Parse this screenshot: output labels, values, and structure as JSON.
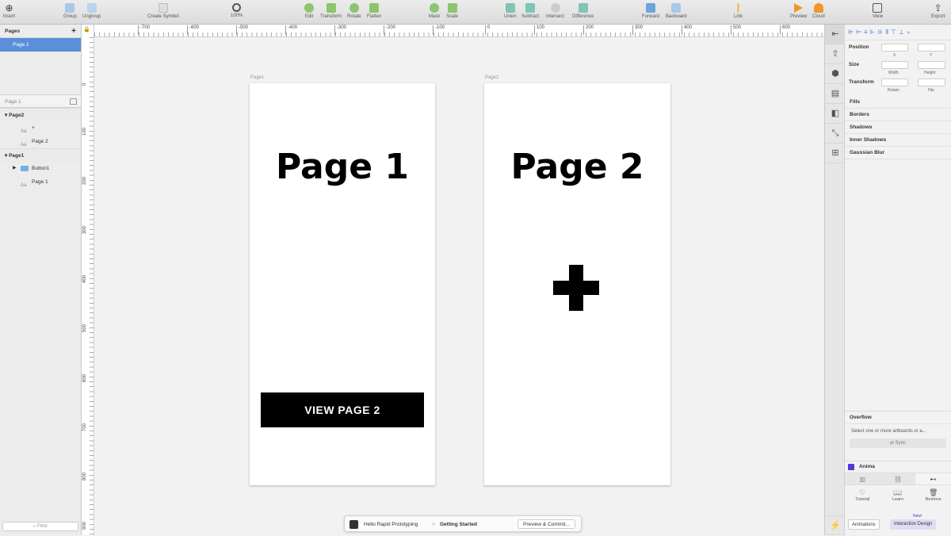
{
  "toolbar": {
    "insert": "Insert",
    "group": "Group",
    "ungroup": "Ungroup",
    "create_symbol": "Create Symbol",
    "zoom": "100%",
    "edit": "Edit",
    "transform": "Transform",
    "rotate": "Rotate",
    "flatten": "Flatten",
    "mask": "Mask",
    "scale": "Scale",
    "union": "Union",
    "subtract": "Subtract",
    "intersect": "Intersect",
    "difference": "Difference",
    "forward": "Forward",
    "backward": "Backward",
    "link": "Link",
    "preview": "Preview",
    "cloud": "Cloud",
    "view": "View",
    "export": "Export"
  },
  "pages_panel": {
    "header": "Pages",
    "add": "+",
    "items": [
      {
        "label": "Page 1"
      }
    ]
  },
  "layers": {
    "filter_header": "Page 1",
    "groups": [
      {
        "name": "Page2",
        "children": [
          {
            "icon": "Aa",
            "label": "+"
          },
          {
            "icon": "Aa",
            "label": "Page 2"
          }
        ]
      },
      {
        "name": "Page1",
        "children": [
          {
            "icon": "folder",
            "label": "Button1"
          },
          {
            "icon": "Aa",
            "label": "Page 1"
          }
        ]
      }
    ],
    "filter_placeholder": "Filter"
  },
  "ruler_h": [
    "-700",
    "-600",
    "-500",
    "-400",
    "-300",
    "-200",
    "-100",
    "0",
    "100",
    "200",
    "300",
    "400",
    "500",
    "600"
  ],
  "ruler_v": [
    "0",
    "100",
    "200",
    "300",
    "400",
    "500",
    "600",
    "700",
    "800",
    "900"
  ],
  "artboards": [
    {
      "label": "Page1",
      "title": "Page 1",
      "button": "VIEW PAGE 2"
    },
    {
      "label": "Page2",
      "title": "Page 2"
    }
  ],
  "statusbar": {
    "project": "Hello Rapid Prototyping",
    "separator": ">",
    "branch": "Getting Started",
    "action": "Preview & Commit..."
  },
  "inspector": {
    "position": "Position",
    "x": "X",
    "y": "Y",
    "size": "Size",
    "width": "Width",
    "height": "Height",
    "transform": "Transform",
    "rotate": "Rotate",
    "flip": "Flip",
    "sections": [
      "Fills",
      "Borders",
      "Shadows",
      "Inner Shadows",
      "Gaussian Blur"
    ],
    "overflow": "Overflow",
    "overflow_msg": "Select one or more artboards or a...",
    "sync": "Sync",
    "anima": "Anima",
    "tutorial": "Tutorial",
    "learn": "Learn",
    "remove": "Remove",
    "new_badge": "New!",
    "animations": "Animations",
    "interaction": "Interaction Design"
  }
}
